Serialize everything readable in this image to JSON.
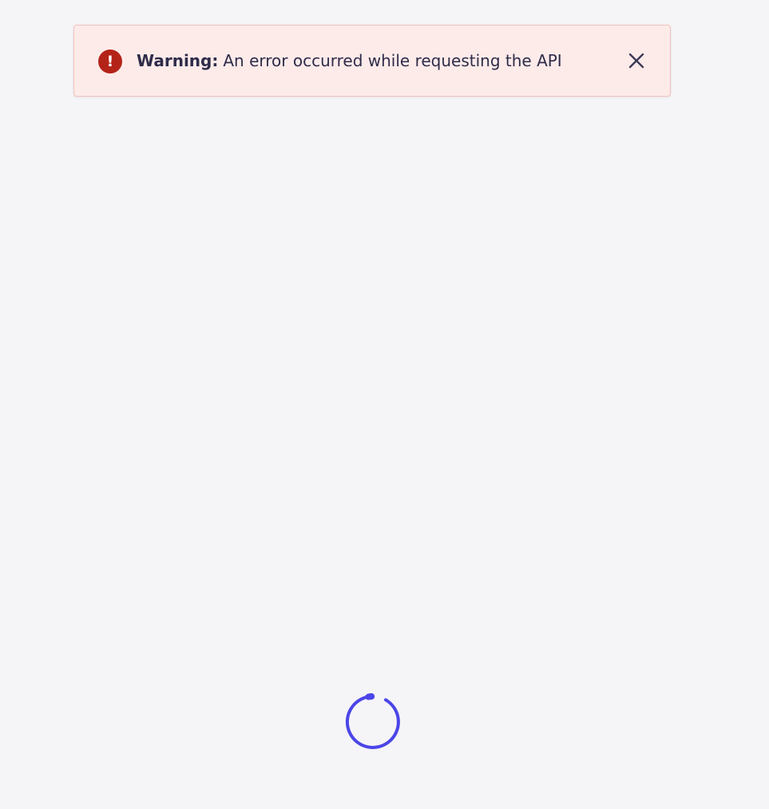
{
  "alert": {
    "severity": "error",
    "icon": "exclamation-circle-icon",
    "icon_glyph": "!",
    "title": "Warning:",
    "message": "An error occurred while requesting the API",
    "close_icon": "close-icon",
    "colors": {
      "background": "#fdebea",
      "border": "#f3c1bd",
      "icon": "#b42318",
      "text": "#2f2c4a"
    }
  },
  "loader": {
    "icon": "loading-spinner-icon",
    "color": "#4b45e8",
    "state": "loading"
  },
  "page": {
    "background": "#f5f4f7"
  }
}
